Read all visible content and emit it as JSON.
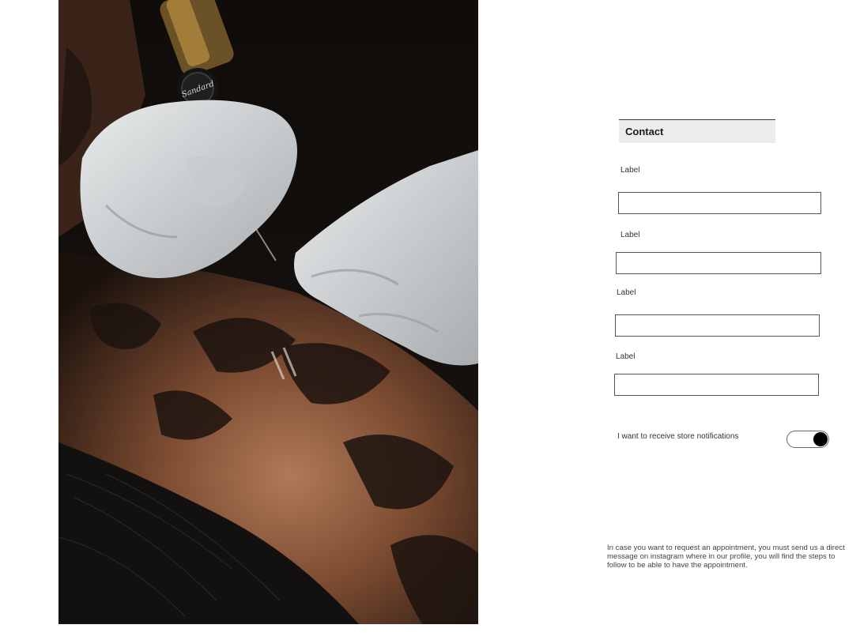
{
  "form": {
    "title": "Contact",
    "fields": [
      {
        "label": "Label",
        "value": ""
      },
      {
        "label": "Label",
        "value": ""
      },
      {
        "label": "Label",
        "value": ""
      },
      {
        "label": "Label",
        "value": ""
      }
    ],
    "notifications": {
      "label": "I want to receive store notifications",
      "enabled": true
    }
  },
  "footnote": "In case you want to request an appointment, you must send us a direct message on instagram where in our profile, you will find the steps to follow to be able to have the appointment.",
  "photo": {
    "subject": "tattoo-artist-photo",
    "machine_brand_text": "Sandard"
  }
}
